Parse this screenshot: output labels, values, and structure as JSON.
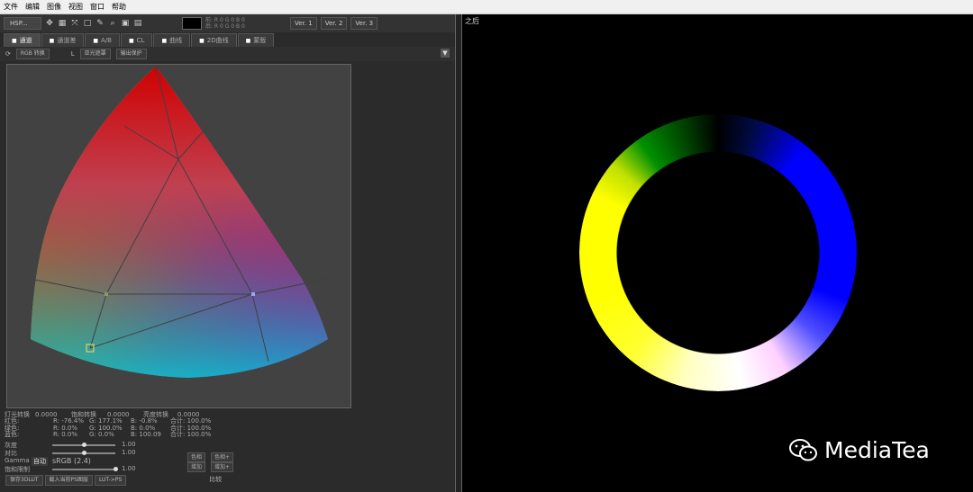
{
  "menu": [
    "文件",
    "编辑",
    "图像",
    "视图",
    "窗口",
    "帮助"
  ],
  "toolbar": {
    "mode": "HSP...",
    "readout_rows": [
      "前: R 0 G 0 B 0",
      "后: R 0 G 0 B 0"
    ],
    "versions": [
      "Ver. 1",
      "Ver. 2",
      "Ver. 3"
    ]
  },
  "tabs": [
    "通道",
    "通道差",
    "A/B",
    "CL",
    "曲线",
    "2D曲线",
    "蒙版"
  ],
  "subbar": {
    "space_select": "RGB 转换",
    "l_label": "L",
    "l_select": "亚光遮罩",
    "protect_button": "输出保护"
  },
  "stats": {
    "rows": [
      [
        "灯光转换",
        "0.0000",
        "饱和转换",
        "0.0000",
        "亮度转换",
        "0.0000"
      ],
      [
        "红色:",
        "R: -76.4%",
        "G: 177.1%",
        "B: -0.8%",
        "合计: 100.0%",
        ""
      ],
      [
        "绿色:",
        "R: 0.0%",
        "G: 100.0%",
        "B: 0.0%",
        "合计: 100.0%",
        ""
      ],
      [
        "蓝色:",
        "R: 0.0%",
        "G: 0.0%",
        "B: 100.09",
        "合计: 100.0%",
        ""
      ]
    ],
    "sliders": [
      {
        "label": "灰度",
        "value": "1.00",
        "level": 0.5
      },
      {
        "label": "对比",
        "value": "1.00",
        "level": 0.5
      },
      {
        "label": "饱和限制",
        "value": "1.00",
        "level": 1.0
      }
    ],
    "gamma_label": "Gamma",
    "gamma_auto": "自动",
    "gamma_value": "sRGB (2.4)",
    "side_buttons": [
      "色相",
      "色相+",
      "增加",
      "增加+"
    ]
  },
  "bottom": {
    "buttons": [
      "保存3DLUT",
      "载入当前PS图层",
      "LUT->PS"
    ],
    "compare": "比较"
  },
  "right": {
    "title": "之后"
  },
  "watermark": "MediaTea"
}
